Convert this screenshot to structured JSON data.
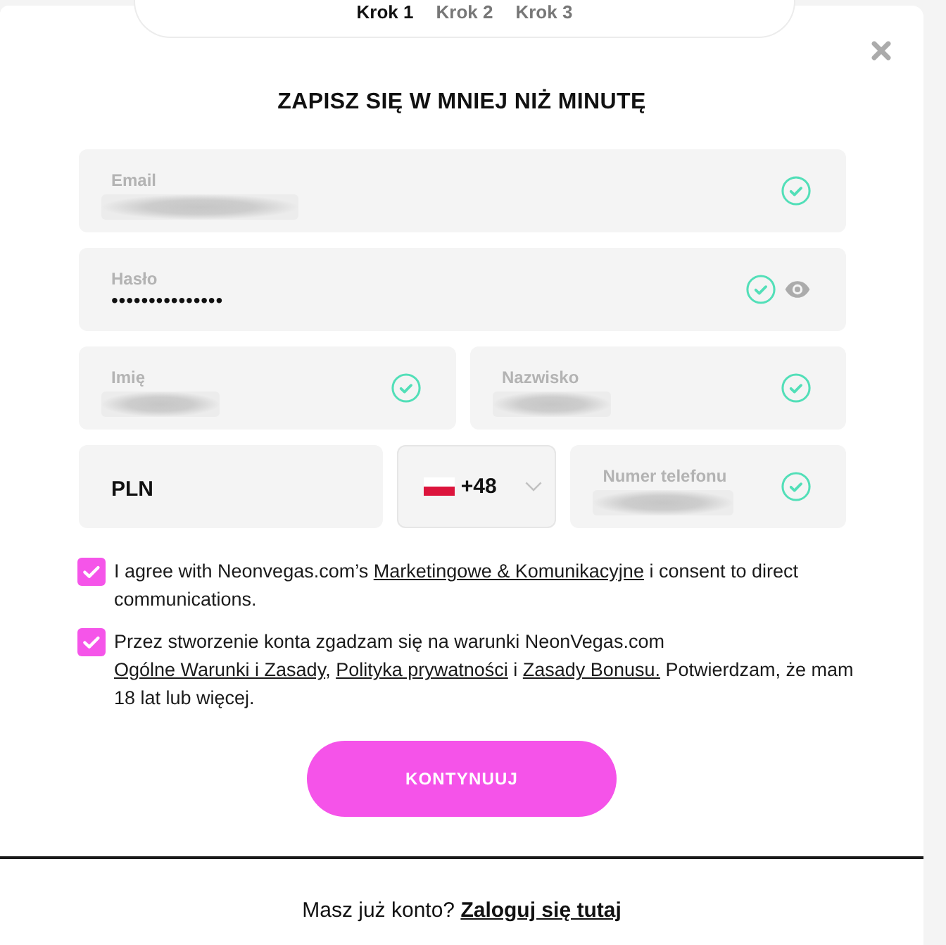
{
  "steps": [
    {
      "label": "Krok 1",
      "selected": true
    },
    {
      "label": "Krok 2",
      "selected": false
    },
    {
      "label": "Krok 3",
      "selected": false
    }
  ],
  "dialog": {
    "title": "ZAPISZ SIĘ W MNIEJ NIŻ MINUTĘ"
  },
  "field_rows": [
    [
      {
        "kind": "email",
        "label": "Email",
        "redacted": true,
        "valid": true
      }
    ],
    [
      {
        "kind": "password",
        "label": "Hasło",
        "value": "•••••••••••••••",
        "valid": true
      }
    ],
    [
      {
        "kind": "text",
        "label": "Imię",
        "redacted": true,
        "valid": true
      },
      {
        "kind": "text",
        "label": "Nazwisko",
        "redacted": true,
        "valid": true
      }
    ],
    [
      {
        "kind": "currency",
        "value": "PLN"
      },
      {
        "kind": "dial_code",
        "value": "+48"
      },
      {
        "kind": "phone",
        "label": "Numer telefonu",
        "redacted": true,
        "valid": true
      }
    ]
  ],
  "consents": [
    {
      "checked": true,
      "parts": [
        {
          "kind": "text",
          "text": "I agree with Neonvegas.com’s "
        },
        {
          "kind": "link",
          "text": "Marketingowe & Komunikacyjne"
        },
        {
          "kind": "text",
          "text": " i consent to direct communications."
        }
      ]
    },
    {
      "checked": true,
      "parts": [
        {
          "kind": "text",
          "text": "Przez stworzenie konta zgadzam się na warunki NeonVegas.com "
        },
        {
          "kind": "link",
          "text": "Ogólne Warunki i Zasady"
        },
        {
          "kind": "text",
          "text": ", "
        },
        {
          "kind": "link",
          "text": "Polityka prywatności"
        },
        {
          "kind": "text",
          "text": " i "
        },
        {
          "kind": "link",
          "text": "Zasady Bonusu."
        },
        {
          "kind": "text",
          "text": " Potwierdzam, że mam 18 lat lub więcej."
        }
      ]
    }
  ],
  "submit": {
    "label": "KONTYNUUJ"
  },
  "footer": {
    "parts": [
      {
        "kind": "text",
        "text": "Masz już konto? "
      },
      {
        "kind": "link",
        "text": "Zaloguj się tutaj"
      }
    ]
  }
}
